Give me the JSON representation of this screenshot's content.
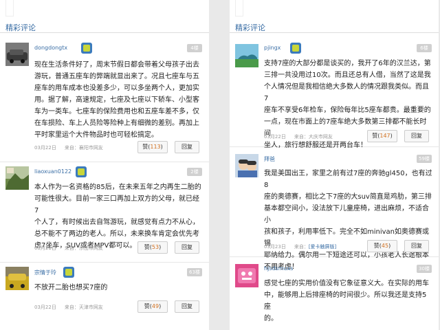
{
  "left": {
    "title": "精彩评论",
    "comments": [
      {
        "user": "dongdongtx",
        "floor": "4楼",
        "lines": [
          "现在生活条件好了，周末节假日都会带着父母孩子出去",
          "游玩，普通五座车的弊端就显出来了。况且七座车与五",
          "座车的用车成本也没差多少，可以多坐两个人，更加实",
          "用。据了解，高速规定，七座及七座以下轿车、小型客",
          "车为一类车。七座车的保险费用也和五座车差不多，仅",
          "在车损险、车上人员险等险种上有细微的差别。再加上",
          "平时家里运个大件物品时也可轻松搞定。"
        ],
        "date": "03月22日",
        "source": "来自：襄阳市网友",
        "like_label": "赞(",
        "like_count": "113",
        "like_close": ")",
        "reply": "回复"
      },
      {
        "user": "liaoxuan0122",
        "floor": "2楼",
        "lines": [
          "本人作为一名资格的85后，在未来五年之内再生二胎的",
          "可能性很大。目前一家三口再加上双方的父母，就已经7",
          "个人了，有时候出去自驾游玩，就感觉有点力不从心，",
          "总不能不了两边的老人。所以，未来换车肯定会优先考",
          "虑7坐车，SUV或者MPV都可以。"
        ],
        "date": "03月21日",
        "source": "来自：乐山市网友",
        "like_label": "赞(",
        "like_count": "53",
        "like_close": ")",
        "reply": "回复"
      },
      {
        "user": "宗情于玲",
        "floor": "63楼",
        "lines": [
          "不放开二胎也想买7座的"
        ],
        "date": "03月22日",
        "source": "来自：天津市网友",
        "like_label": "赞(",
        "like_count": "49",
        "like_close": ")",
        "reply": "回复"
      }
    ]
  },
  "right": {
    "title": "精彩评论",
    "comments": [
      {
        "user": "pjingx",
        "floor": "6楼",
        "lines": [
          "支持7座的大部分都是谈买的，我开了6年的汉兰达，第",
          "三排一共没用过10次。而且还总有人借，当然了这是我",
          "个人情况但是我相信绝大多数人的情况跟我类似。而且7",
          "座车不享受6年检车，保险每年比5座车都贵。最重要的",
          "一点，现在市面上的7座车绝大多数第三排都不能长时间",
          "坐人，旅行想舒服还是开两台车！"
        ],
        "date": "03月22日",
        "source": "来自：大庆市网友",
        "like_label": "赞(",
        "like_count": "147",
        "like_close": ")",
        "reply": "回复"
      },
      {
        "user": "拜爸",
        "floor": "59楼",
        "lines": [
          "我是美国出王，家里之前有过7座的奔驰gl450，也有过8",
          "座的奥德赛，相比之下7座的大suv简直是鸡肋，第三排",
          "基本都空间小，没法放下儿童座椅，进出麻烦，不适合小",
          "孩和孩子，利用率低下。完全不如minivan如奥德赛或锡",
          "耶纳给力。偶尔用一下短途还可以，小孩老人长途根本",
          "不用考虑！"
        ],
        "date": "03月23日",
        "source": "来自：",
        "source_link": "[爱卡触屏版]",
        "like_label": "赞(",
        "like_count": "45",
        "like_close": ")",
        "reply": "回复"
      },
      {
        "user": "hjsdsmuxs",
        "floor": "30楼",
        "lines": [
          "感觉七座的实用价值没有它象征意义大。在实际的用车",
          "中，能够用上后排座椅的时间很少。所以我还是支持5座",
          "的。"
        ]
      }
    ]
  },
  "colors": {
    "link": "#3a6ea5",
    "badge_bg": "#3b7bbd",
    "badge_fg": "#c8d63a",
    "count": "#d07020"
  }
}
